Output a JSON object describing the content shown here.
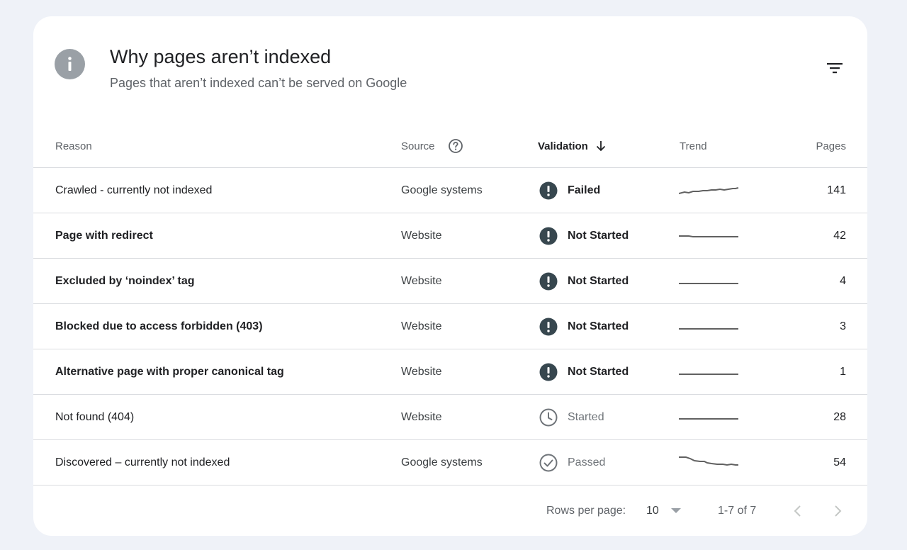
{
  "header": {
    "title": "Why pages aren’t indexed",
    "subtitle": "Pages that aren’t indexed can’t be served on Google"
  },
  "columns": {
    "reason": "Reason",
    "source": "Source",
    "validation": "Validation",
    "trend": "Trend",
    "pages": "Pages"
  },
  "rows": [
    {
      "reason": "Crawled - currently not indexed",
      "source": "Google systems",
      "validation": "Failed",
      "pages": "141"
    },
    {
      "reason": "Page with redirect",
      "source": "Website",
      "validation": "Not Started",
      "pages": "42"
    },
    {
      "reason": "Excluded by ‘noindex’ tag",
      "source": "Website",
      "validation": "Not Started",
      "pages": "4"
    },
    {
      "reason": "Blocked due to access forbidden (403)",
      "source": "Website",
      "validation": "Not Started",
      "pages": "3"
    },
    {
      "reason": "Alternative page with proper canonical tag",
      "source": "Website",
      "validation": "Not Started",
      "pages": "1"
    },
    {
      "reason": "Not found (404)",
      "source": "Website",
      "validation": "Started",
      "pages": "28"
    },
    {
      "reason": "Discovered – currently not indexed",
      "source": "Google systems",
      "validation": "Passed",
      "pages": "54"
    }
  ],
  "footer": {
    "rows_per_page_label": "Rows per page:",
    "rows_per_page_value": "10",
    "range": "1-7 of 7"
  },
  "colors": {
    "alert_icon": "#37474f",
    "muted_icon": "#70757a",
    "trend_line": "#616161",
    "divider": "#dadce0"
  }
}
